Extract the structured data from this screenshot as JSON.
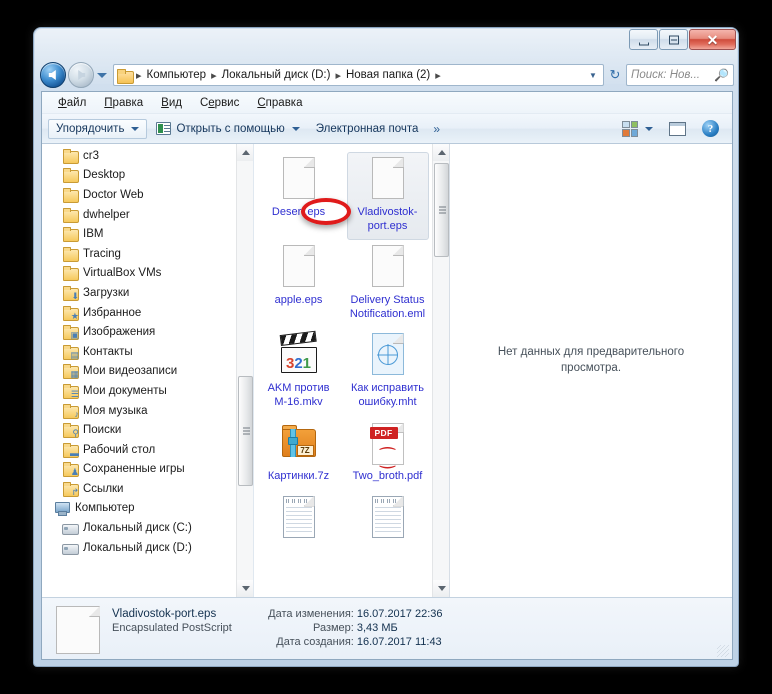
{
  "window": {
    "caption_buttons": [
      {
        "name": "minimize",
        "glyph": "minimize-icon"
      },
      {
        "name": "maximize",
        "glyph": "maximize-icon"
      },
      {
        "name": "close",
        "glyph": "✕"
      }
    ]
  },
  "address_bar": {
    "back_tooltip": "Назад",
    "forward_tooltip": "Вперед",
    "crumbs": [
      "Компьютер",
      "Локальный диск (D:)",
      "Новая папка (2)"
    ],
    "refresh_glyph": "↻",
    "search_placeholder": "Поиск: Нов...",
    "search_value": "",
    "search_icon": "search-icon"
  },
  "menubar": {
    "items": [
      {
        "pre": "",
        "acc": "Ф",
        "post": "айл"
      },
      {
        "pre": "",
        "acc": "П",
        "post": "равка"
      },
      {
        "pre": "",
        "acc": "В",
        "post": "ид"
      },
      {
        "pre": "С",
        "acc": "е",
        "post": "рвис"
      },
      {
        "pre": "",
        "acc": "С",
        "post": "правка"
      }
    ]
  },
  "toolbar": {
    "organize": "Упорядочить",
    "open_with": "Открыть с помощью",
    "email": "Электронная почта",
    "overflow": "»",
    "change_view_icon": "view-options-icon",
    "preview_pane_icon": "preview-pane-icon",
    "help_icon": "?"
  },
  "navigation_pane": {
    "items": [
      {
        "label": "cr3",
        "icon": "folder-icon",
        "level": 2
      },
      {
        "label": "Desktop",
        "icon": "folder-icon",
        "level": 2
      },
      {
        "label": "Doctor Web",
        "icon": "folder-icon",
        "level": 2
      },
      {
        "label": "dwhelper",
        "icon": "folder-icon",
        "level": 2
      },
      {
        "label": "IBM",
        "icon": "folder-icon",
        "level": 2
      },
      {
        "label": "Tracing",
        "icon": "folder-icon",
        "level": 2
      },
      {
        "label": "VirtualBox VMs",
        "icon": "folder-icon",
        "level": 2
      },
      {
        "label": "Загрузки",
        "icon": "folder-downloads-icon",
        "level": 2
      },
      {
        "label": "Избранное",
        "icon": "folder-favorites-icon",
        "level": 2
      },
      {
        "label": "Изображения",
        "icon": "folder-pictures-icon",
        "level": 2
      },
      {
        "label": "Контакты",
        "icon": "folder-contacts-icon",
        "level": 2
      },
      {
        "label": "Мои видеозаписи",
        "icon": "folder-videos-icon",
        "level": 2
      },
      {
        "label": "Мои документы",
        "icon": "folder-documents-icon",
        "level": 2
      },
      {
        "label": "Моя музыка",
        "icon": "folder-music-icon",
        "level": 2
      },
      {
        "label": "Поиски",
        "icon": "folder-searches-icon",
        "level": 2
      },
      {
        "label": "Рабочий стол",
        "icon": "folder-desktop-icon",
        "level": 2
      },
      {
        "label": "Сохраненные игры",
        "icon": "folder-savedgames-icon",
        "level": 2
      },
      {
        "label": "Ссылки",
        "icon": "folder-links-icon",
        "level": 2
      },
      {
        "label": "Компьютер",
        "icon": "computer-icon",
        "level": 1
      },
      {
        "label": "Локальный диск (C:)",
        "icon": "drive-system-icon",
        "level": 2
      },
      {
        "label": "Локальный диск (D:)",
        "icon": "drive-icon",
        "level": 2
      }
    ]
  },
  "file_list": {
    "items": [
      {
        "label": "Desert.eps",
        "icon": "blank-document-icon",
        "selected": false,
        "annotated": true
      },
      {
        "label": "Vladivostok-port.eps",
        "icon": "blank-document-icon",
        "selected": true,
        "annotated": false
      },
      {
        "label": "apple.eps",
        "icon": "blank-document-icon",
        "selected": false,
        "annotated": false
      },
      {
        "label": "Delivery Status Notification.eml",
        "icon": "blank-document-icon",
        "selected": false,
        "annotated": false
      },
      {
        "label": "AKM против M-16.mkv",
        "icon": "media-player-classic-icon",
        "selected": false,
        "annotated": false
      },
      {
        "label": "Как исправить ошибку.mht",
        "icon": "web-archive-icon",
        "selected": false,
        "annotated": false
      },
      {
        "label": "Картинки.7z",
        "icon": "seven-zip-archive-icon",
        "selected": false,
        "annotated": false
      },
      {
        "label": "Two_broth.pdf",
        "icon": "pdf-document-icon",
        "selected": false,
        "annotated": false
      },
      {
        "label": "",
        "icon": "text-document-icon",
        "selected": false,
        "annotated": false
      },
      {
        "label": "",
        "icon": "text-document-icon",
        "selected": false,
        "annotated": false
      }
    ]
  },
  "preview_pane": {
    "message": "Нет данных для предварительного просмотра."
  },
  "details_pane": {
    "file_name": "Vladivostok-port.eps",
    "file_type": "Encapsulated PostScript",
    "rows": [
      {
        "key": "Дата изменения:",
        "value": "16.07.2017 22:36"
      },
      {
        "key": "Размер:",
        "value": "3,43 МБ"
      },
      {
        "key": "Дата создания:",
        "value": "16.07.2017 11:43"
      }
    ]
  },
  "annotation": {
    "color": "#e01b1b",
    "shape": "ellipse",
    "target_text": ".eps"
  }
}
